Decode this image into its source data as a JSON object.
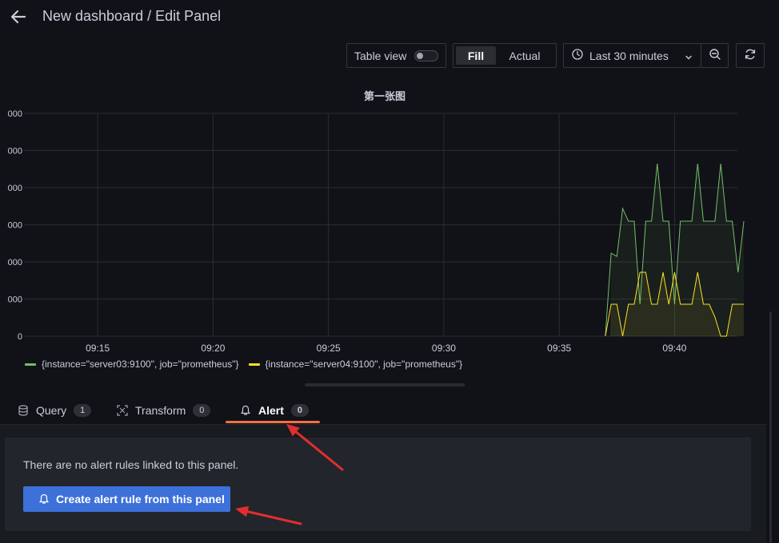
{
  "header": {
    "title": "New dashboard / Edit Panel"
  },
  "toolbar": {
    "table_view_label": "Table view",
    "fill_label": "Fill",
    "actual_label": "Actual",
    "time_range_label": "Last 30 minutes"
  },
  "chart_data": {
    "type": "line",
    "title": "第一张图",
    "x_labels": [
      "09:15",
      "09:20",
      "09:25",
      "09:30",
      "09:35",
      "09:40"
    ],
    "y_labels": [
      "0",
      "000",
      "000",
      "000",
      "000",
      "000",
      "000"
    ],
    "grid": true,
    "legend_position": "bottom-left",
    "series": [
      {
        "name": "{instance=\"server03:9100\", job=\"prometheus\"}",
        "color": "#73bf69",
        "x": [
          "09:37:00",
          "09:37:15",
          "09:37:30",
          "09:37:45",
          "09:38:00",
          "09:38:15",
          "09:38:30",
          "09:38:45",
          "09:39:00",
          "09:39:15",
          "09:39:30",
          "09:39:45",
          "09:40:00",
          "09:40:15",
          "09:40:30",
          "09:40:45",
          "09:41:00",
          "09:41:15",
          "09:41:30",
          "09:41:45",
          "09:42:00",
          "09:42:15",
          "09:42:30",
          "09:42:45",
          "09:43:00"
        ],
        "y": [
          0,
          2.6,
          2.5,
          4.0,
          3.6,
          3.6,
          1.0,
          3.6,
          3.6,
          5.4,
          3.6,
          3.6,
          1.0,
          3.6,
          3.6,
          3.6,
          5.4,
          3.6,
          3.6,
          3.6,
          5.4,
          3.6,
          3.6,
          2.0,
          3.6
        ]
      },
      {
        "name": "{instance=\"server04:9100\", job=\"prometheus\"}",
        "color": "#fade2a",
        "x": [
          "09:37:00",
          "09:37:15",
          "09:37:30",
          "09:37:45",
          "09:38:00",
          "09:38:15",
          "09:38:30",
          "09:38:45",
          "09:39:00",
          "09:39:15",
          "09:39:30",
          "09:39:45",
          "09:40:00",
          "09:40:15",
          "09:40:30",
          "09:40:45",
          "09:41:00",
          "09:41:15",
          "09:41:30",
          "09:41:45",
          "09:42:00",
          "09:42:15",
          "09:42:30",
          "09:42:45",
          "09:43:00"
        ],
        "y": [
          0,
          1.0,
          1.0,
          0,
          1.0,
          1.0,
          2.0,
          2.0,
          1.0,
          1.0,
          2.0,
          1.0,
          2.0,
          1.0,
          1.0,
          1.0,
          2.0,
          1.0,
          1.0,
          0.6,
          0,
          0,
          1.0,
          1.0,
          1.0
        ]
      }
    ]
  },
  "tabs": [
    {
      "label": "Query",
      "count": "1",
      "icon": "database-icon"
    },
    {
      "label": "Transform",
      "count": "0",
      "icon": "transform-icon"
    },
    {
      "label": "Alert",
      "count": "0",
      "icon": "bell-icon"
    }
  ],
  "alert": {
    "message": "There are no alert rules linked to this panel.",
    "create_button_label": "Create alert rule from this panel"
  },
  "annotation_color": "#e02f2f"
}
